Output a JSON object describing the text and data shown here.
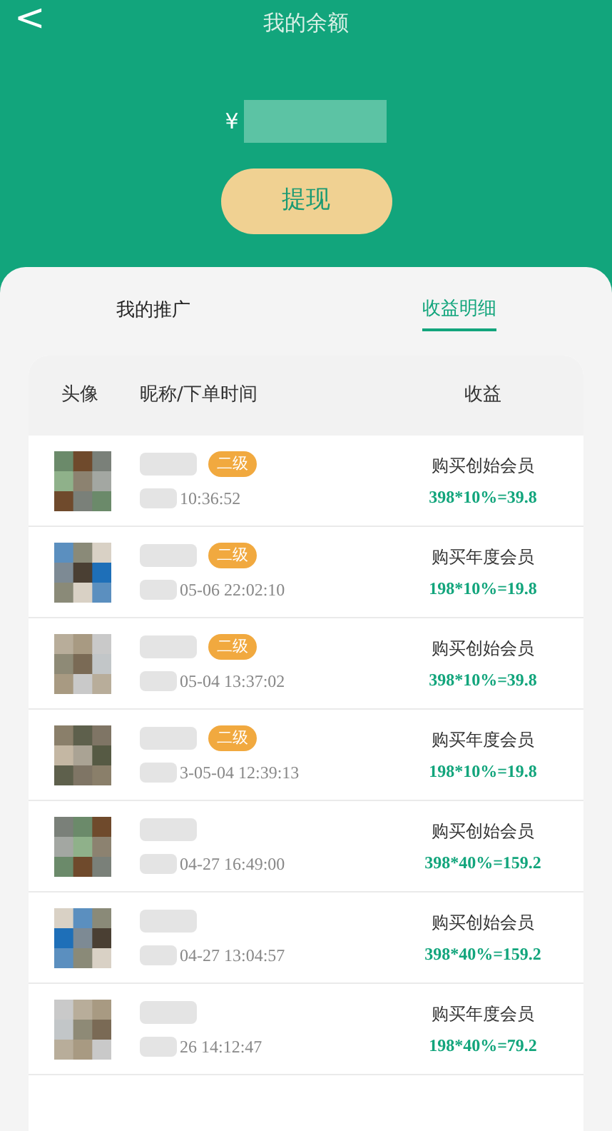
{
  "header": {
    "back": "<",
    "title": "我的余额"
  },
  "balance": {
    "currency": "¥"
  },
  "withdraw_button": "提现",
  "tabs": [
    {
      "label": "我的推广",
      "selected": false
    },
    {
      "label": "收益明细",
      "selected": true
    }
  ],
  "table": {
    "columns": [
      "头像",
      "昵称/下单时间",
      "收益"
    ],
    "rows": [
      {
        "badge": "二级",
        "time": "10:36:52",
        "item": "购买创始会员",
        "formula": "398*10%=39.8"
      },
      {
        "badge": "二级",
        "time": "05-06 22:02:10",
        "item": "购买年度会员",
        "formula": "198*10%=19.8"
      },
      {
        "badge": "二级",
        "time": "05-04 13:37:02",
        "item": "购买创始会员",
        "formula": "398*10%=39.8"
      },
      {
        "badge": "二级",
        "time": "3-05-04 12:39:13",
        "item": "购买年度会员",
        "formula": "198*10%=19.8"
      },
      {
        "time": "04-27 16:49:00",
        "item": "购买创始会员",
        "formula": "398*40%=159.2"
      },
      {
        "time": "04-27 13:04:57",
        "item": "购买创始会员",
        "formula": "398*40%=159.2"
      },
      {
        "time": "26 14:12:47",
        "item": "购买年度会员",
        "formula": "198*40%=79.2"
      }
    ]
  }
}
